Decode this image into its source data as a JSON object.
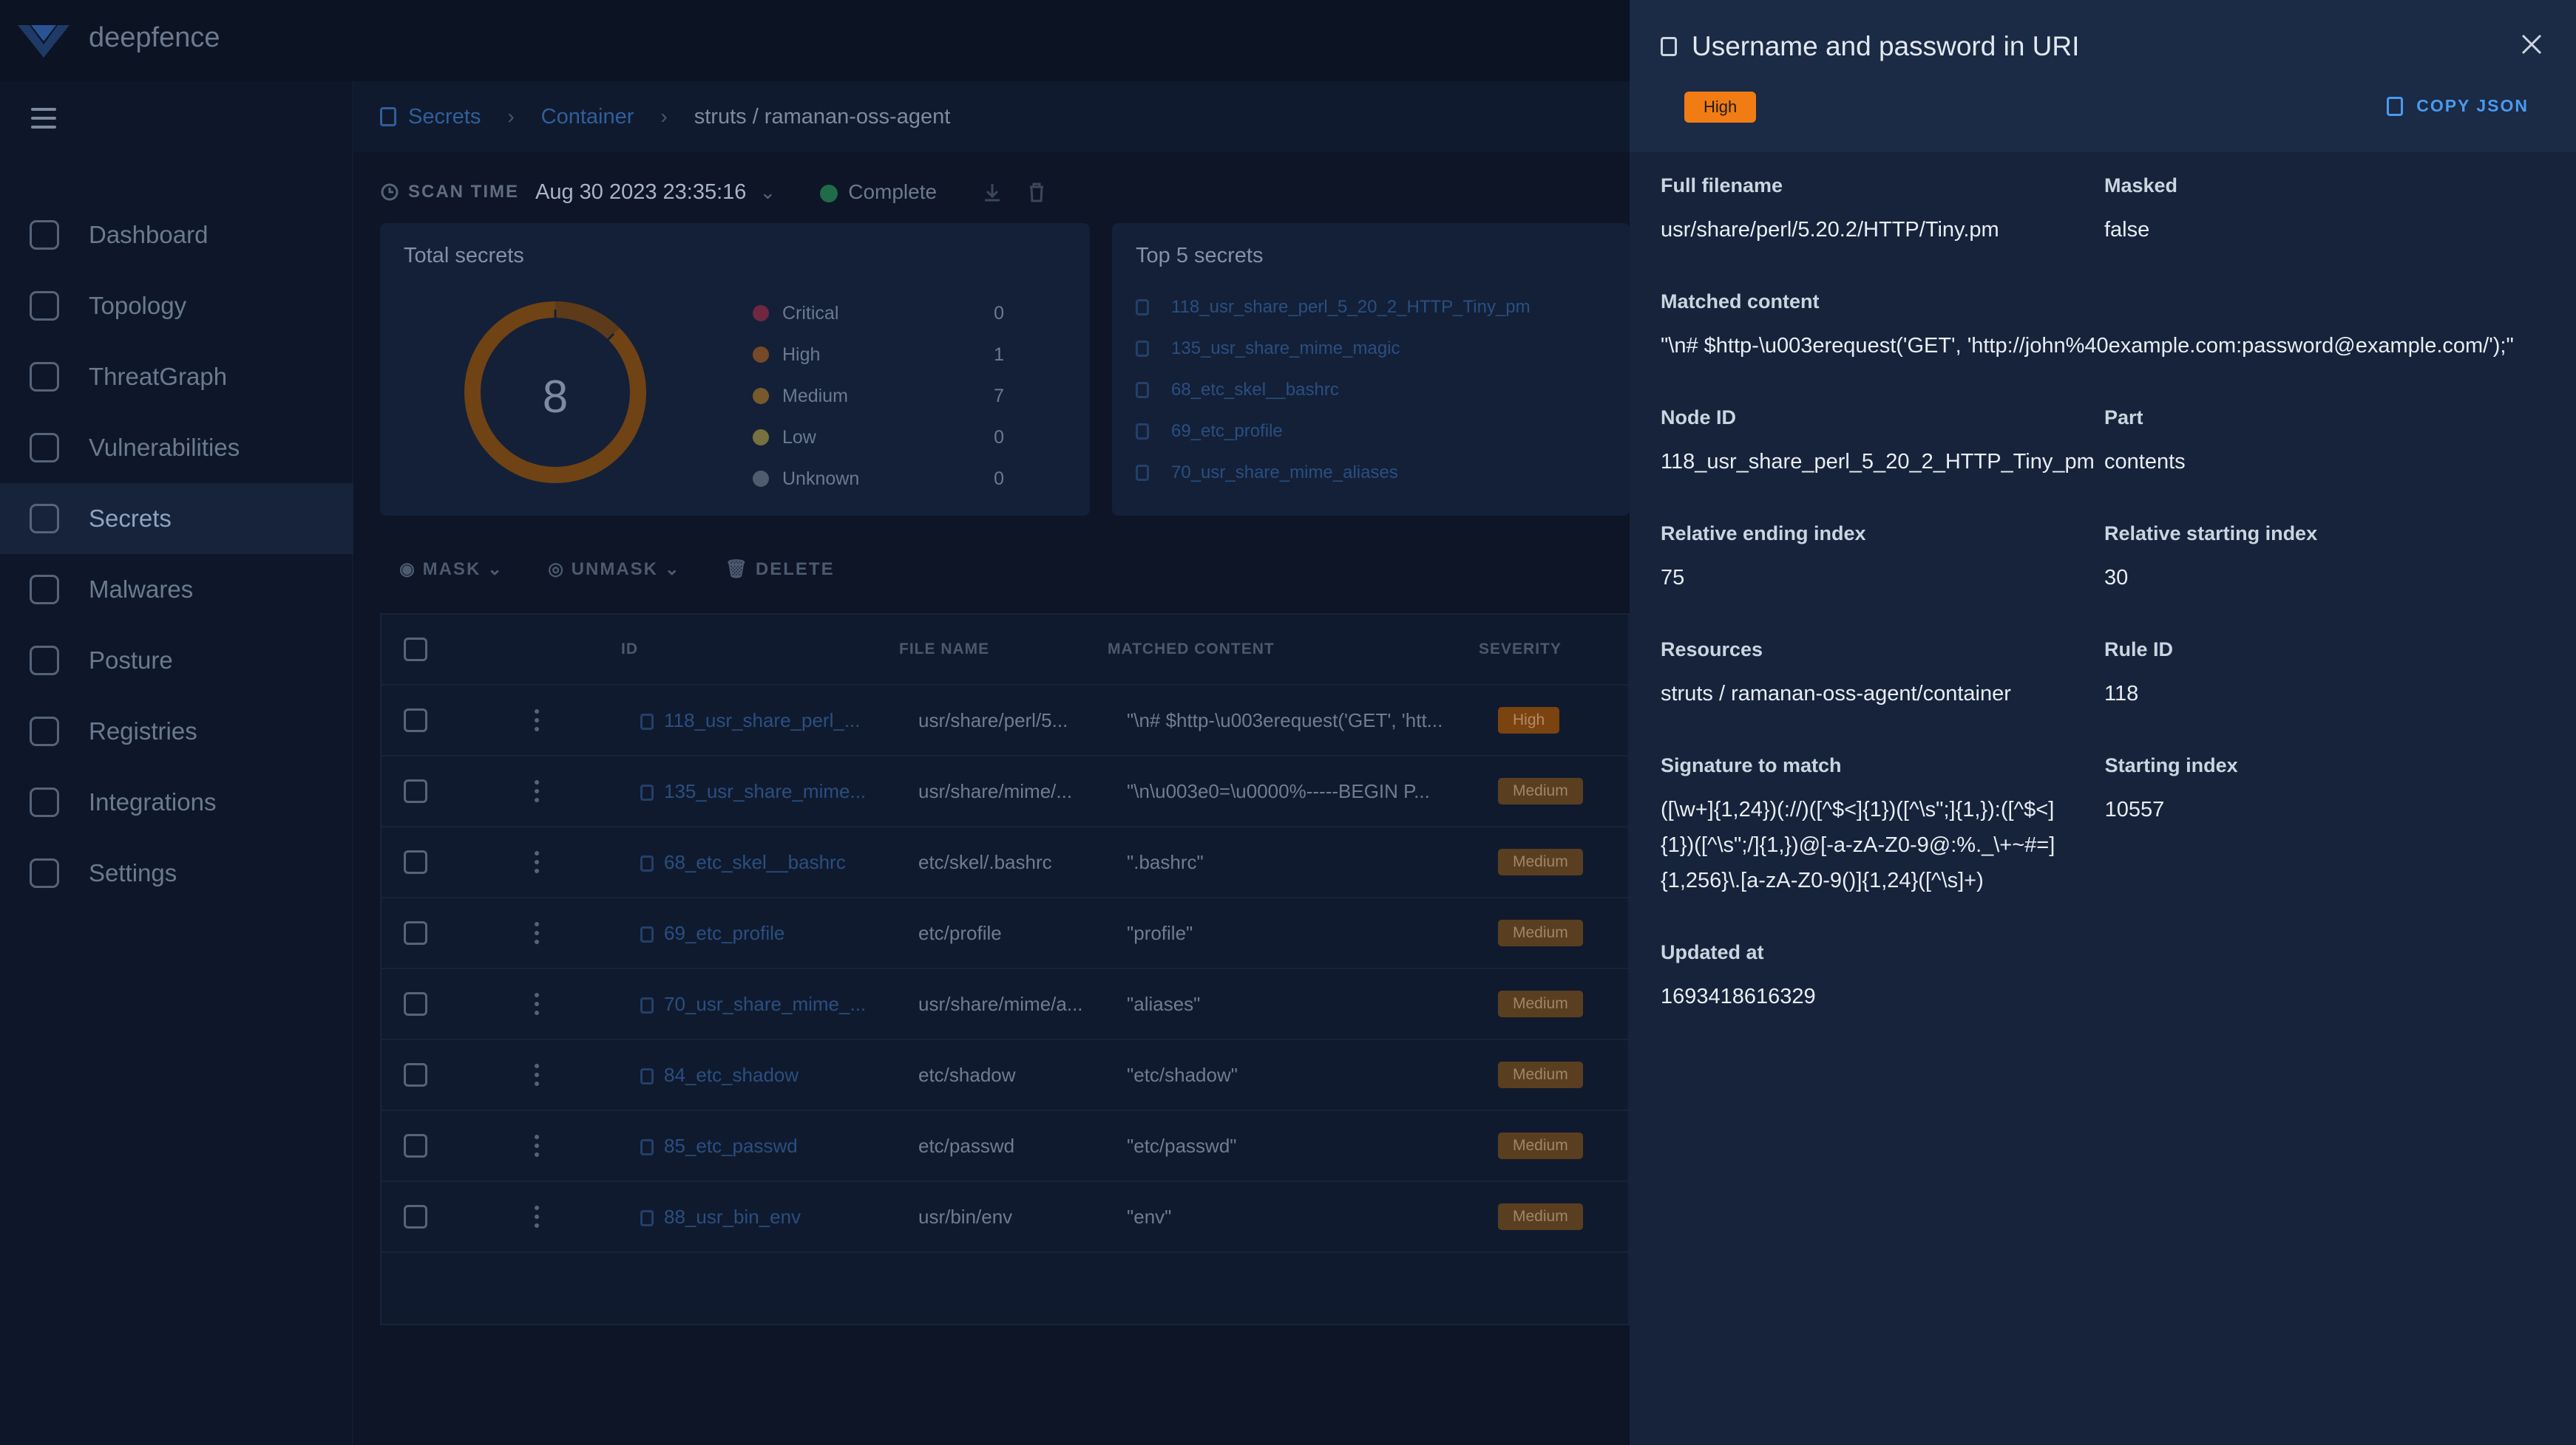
{
  "brand": "deepfence",
  "nav": [
    {
      "label": "Dashboard",
      "icon": "dashboard-icon"
    },
    {
      "label": "Topology",
      "icon": "topology-icon"
    },
    {
      "label": "ThreatGraph",
      "icon": "threatgraph-icon"
    },
    {
      "label": "Vulnerabilities",
      "icon": "bug-icon"
    },
    {
      "label": "Secrets",
      "icon": "lock-icon"
    },
    {
      "label": "Malwares",
      "icon": "virus-icon"
    },
    {
      "label": "Posture",
      "icon": "shield-icon"
    },
    {
      "label": "Registries",
      "icon": "registry-icon"
    },
    {
      "label": "Integrations",
      "icon": "puzzle-icon"
    },
    {
      "label": "Settings",
      "icon": "gear-icon"
    }
  ],
  "breadcrumb": {
    "first": "Secrets",
    "second": "Container",
    "current": "struts / ramanan-oss-agent"
  },
  "scan": {
    "label": "SCAN TIME",
    "time": "Aug 30 2023 23:35:16",
    "status": "Complete"
  },
  "total_card": {
    "title": "Total secrets",
    "total": "8",
    "legend": [
      {
        "label": "Critical",
        "value": "0",
        "color": "#e0344a"
      },
      {
        "label": "High",
        "value": "1",
        "color": "#f27c14"
      },
      {
        "label": "Medium",
        "value": "7",
        "color": "#f4a020"
      },
      {
        "label": "Low",
        "value": "0",
        "color": "#f0d44a"
      },
      {
        "label": "Unknown",
        "value": "0",
        "color": "#9aa4b2"
      }
    ]
  },
  "top5_card": {
    "title": "Top 5 secrets",
    "items": [
      "118_usr_share_perl_5_20_2_HTTP_Tiny_pm",
      "135_usr_share_mime_magic",
      "68_etc_skel__bashrc",
      "69_etc_profile",
      "70_usr_share_mime_aliases"
    ]
  },
  "actions": {
    "mask": "MASK",
    "unmask": "UNMASK",
    "delete": "DELETE"
  },
  "table": {
    "headers": {
      "id": "ID",
      "file": "FILE NAME",
      "match": "MATCHED CONTENT",
      "severity": "SEVERITY"
    },
    "rows": [
      {
        "id": "118_usr_share_perl_...",
        "file": "usr/share/perl/5...",
        "match": "\"\\n# $http-\\u003erequest('GET', 'htt...",
        "severity": "High"
      },
      {
        "id": "135_usr_share_mime...",
        "file": "usr/share/mime/...",
        "match": "\"\\n\\u003e0=\\u0000%-----BEGIN P...",
        "severity": "Medium"
      },
      {
        "id": "68_etc_skel__bashrc",
        "file": "etc/skel/.bashrc",
        "match": "\".bashrc\"",
        "severity": "Medium"
      },
      {
        "id": "69_etc_profile",
        "file": "etc/profile",
        "match": "\"profile\"",
        "severity": "Medium"
      },
      {
        "id": "70_usr_share_mime_...",
        "file": "usr/share/mime/a...",
        "match": "\"aliases\"",
        "severity": "Medium"
      },
      {
        "id": "84_etc_shadow",
        "file": "etc/shadow",
        "match": "\"etc/shadow\"",
        "severity": "Medium"
      },
      {
        "id": "85_etc_passwd",
        "file": "etc/passwd",
        "match": "\"etc/passwd\"",
        "severity": "Medium"
      },
      {
        "id": "88_usr_bin_env",
        "file": "usr/bin/env",
        "match": "\"env\"",
        "severity": "Medium"
      }
    ]
  },
  "drawer": {
    "title": "Username and password in URI",
    "severity": "High",
    "copy_label": "COPY JSON",
    "fields": {
      "full_filename": {
        "label": "Full filename",
        "value": "usr/share/perl/5.20.2/HTTP/Tiny.pm"
      },
      "masked": {
        "label": "Masked",
        "value": "false"
      },
      "matched_content": {
        "label": "Matched content",
        "value": "\"\\n# $http-\\u003erequest('GET', 'http://john%40example.com:password@example.com/');\""
      },
      "node_id": {
        "label": "Node ID",
        "value": "118_usr_share_perl_5_20_2_HTTP_Tiny_pm"
      },
      "part": {
        "label": "Part",
        "value": "contents"
      },
      "rel_end": {
        "label": "Relative ending index",
        "value": "75"
      },
      "rel_start": {
        "label": "Relative starting index",
        "value": "30"
      },
      "resources": {
        "label": "Resources",
        "value": "struts / ramanan-oss-agent/container"
      },
      "rule_id": {
        "label": "Rule ID",
        "value": "118"
      },
      "signature": {
        "label": "Signature to match",
        "value": "([\\w+]{1,24})(://)([^$<]{1})([^\\s\";]{1,}):([^$<]{1})([^\\s\";/]{1,})@[-a-zA-Z0-9@:%._\\+~#=]{1,256}\\.[a-zA-Z0-9()]{1,24}([^\\s]+)"
      },
      "start_index": {
        "label": "Starting index",
        "value": "10557"
      },
      "updated_at": {
        "label": "Updated at",
        "value": "1693418616329"
      }
    }
  }
}
